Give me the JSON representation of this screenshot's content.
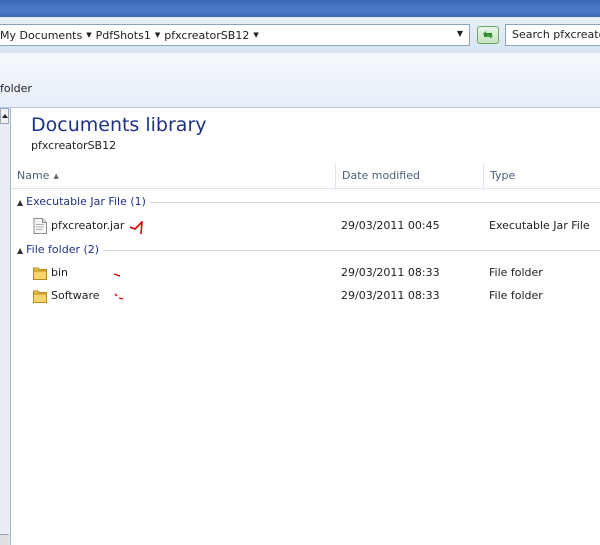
{
  "address_bar": {
    "crumbs": [
      "My Documents",
      "PdfShots1",
      "pfxcreatorSB12"
    ],
    "search_placeholder": "Search pfxcreator"
  },
  "toolbar": {
    "new_folder_label": "folder"
  },
  "library": {
    "title": "Documents library",
    "subtitle": "pfxcreatorSB12"
  },
  "columns": {
    "name": "Name",
    "date_modified": "Date modified",
    "type": "Type"
  },
  "groups": [
    {
      "label": "Executable Jar File (1)",
      "items": [
        {
          "name": "pfxcreator.jar",
          "date": "29/03/2011 00:45",
          "type": "Executable Jar File",
          "icon": "jar-file-icon"
        }
      ]
    },
    {
      "label": "File folder (2)",
      "items": [
        {
          "name": "bin",
          "date": "29/03/2011 08:33",
          "type": "File folder",
          "icon": "folder-icon"
        },
        {
          "name": "Software",
          "date": "29/03/2011 08:33",
          "type": "File folder",
          "icon": "folder-icon"
        }
      ]
    }
  ],
  "colors": {
    "title_blue": "#1e3287",
    "annotation_red": "#e00000"
  }
}
